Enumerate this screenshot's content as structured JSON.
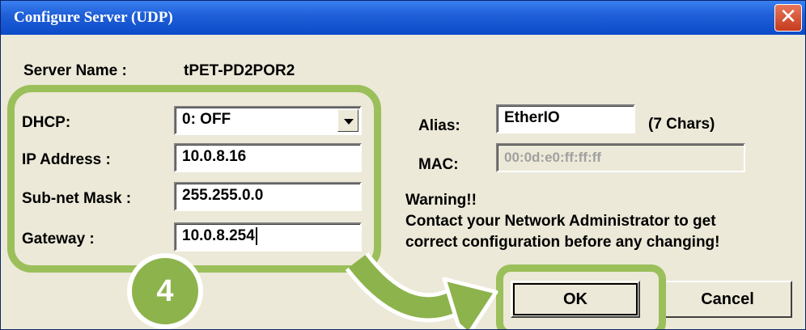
{
  "window": {
    "title": "Configure Server (UDP)",
    "close_symbol": "✕"
  },
  "server": {
    "label": "Server Name :",
    "value": "tPET-PD2POR2"
  },
  "dhcp": {
    "label": "DHCP:",
    "value": "0: OFF"
  },
  "ip": {
    "label": "IP Address :",
    "value": "10.0.8.16"
  },
  "mask": {
    "label": "Sub-net Mask :",
    "value": "255.255.0.0"
  },
  "gateway": {
    "label": "Gateway :",
    "value": "10.0.8.254"
  },
  "alias": {
    "label": "Alias:",
    "value": "EtherIO",
    "hint": "(7 Chars)"
  },
  "mac": {
    "label": "MAC:",
    "value": "00:0d:e0:ff:ff:ff"
  },
  "warning": {
    "title": "Warning!!",
    "line1": "Contact your Network Administrator to get",
    "line2": "correct  configuration before any changing!"
  },
  "buttons": {
    "ok": "OK",
    "cancel": "Cancel"
  },
  "annotation": {
    "step": "4",
    "color": "#8db34c"
  }
}
